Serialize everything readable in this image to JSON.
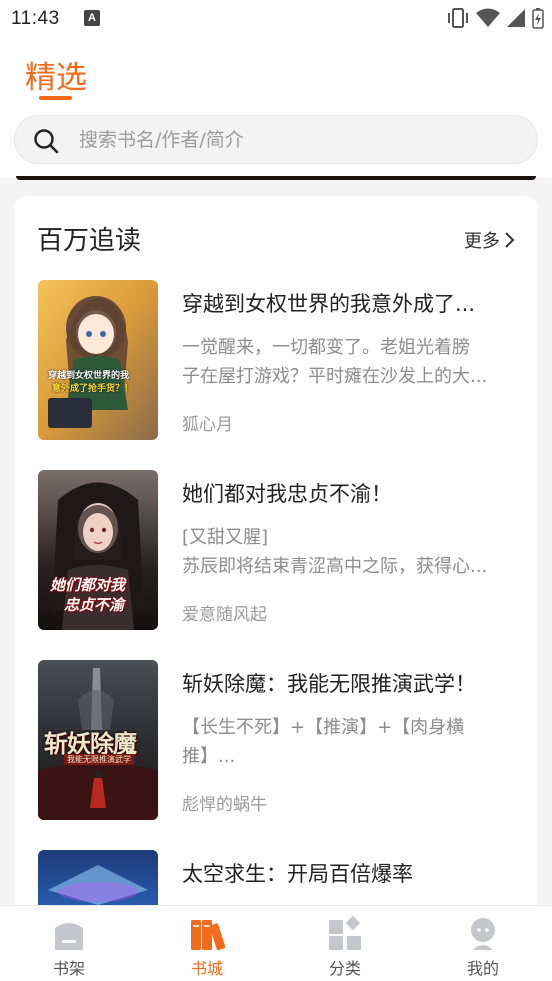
{
  "status_bar": {
    "time": "11:43",
    "notification_badge": "A",
    "icons": [
      "vibrate-icon",
      "wifi-icon",
      "signal-icon",
      "battery-charging-icon"
    ]
  },
  "header": {
    "tab_title": "精选",
    "accent_color": "#f26a1b"
  },
  "search": {
    "placeholder": "搜索书名/作者/简介"
  },
  "section": {
    "title": "百万追读",
    "more_label": "更多"
  },
  "books": [
    {
      "title": "穿越到女权世界的我意外成了...",
      "desc_lines": [
        "一觉醒来，一切都变了。老姐光着膀",
        "子在屋打游戏？平时瘫在沙发上的大..."
      ],
      "author": "狐心月",
      "cover_text": [
        "穿越到女权世界的我",
        "意外成了抢手货？！"
      ]
    },
    {
      "title": "她们都对我忠贞不渝！",
      "desc_lines": [
        "[又甜又腥]",
        "苏辰即将结束青涩高中之际，获得心..."
      ],
      "author": "爱意随风起",
      "cover_text": [
        "她们都对我",
        "忠贞不渝"
      ]
    },
    {
      "title": "斩妖除魔：我能无限推演武学！",
      "desc_lines": [
        "【长生不死】+【推演】+【肉身横",
        "推】..."
      ],
      "author": "彪悍的蜗牛",
      "cover_text": [
        "斩妖除魔",
        "我能无限推演武学"
      ]
    },
    {
      "title": "太空求生：开局百倍爆率",
      "desc_lines": [],
      "author": "",
      "cover_text": []
    }
  ],
  "bottom_nav": [
    {
      "label": "书架",
      "icon": "bookshelf-icon",
      "active": false
    },
    {
      "label": "书城",
      "icon": "bookstore-icon",
      "active": true
    },
    {
      "label": "分类",
      "icon": "category-icon",
      "active": false
    },
    {
      "label": "我的",
      "icon": "profile-icon",
      "active": false
    }
  ]
}
